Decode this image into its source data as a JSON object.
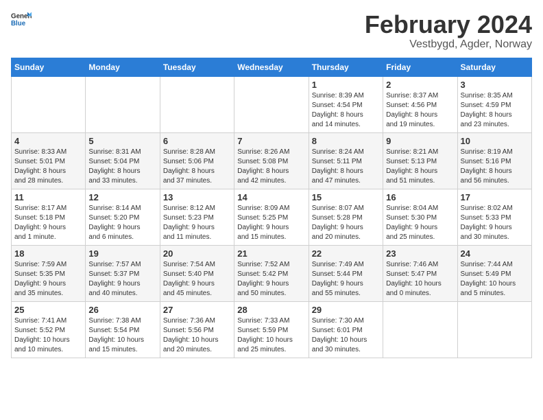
{
  "header": {
    "logo_general": "General",
    "logo_blue": "Blue",
    "title": "February 2024",
    "subtitle": "Vestbygd, Agder, Norway"
  },
  "calendar": {
    "days_of_week": [
      "Sunday",
      "Monday",
      "Tuesday",
      "Wednesday",
      "Thursday",
      "Friday",
      "Saturday"
    ],
    "weeks": [
      [
        {
          "day": "",
          "info": ""
        },
        {
          "day": "",
          "info": ""
        },
        {
          "day": "",
          "info": ""
        },
        {
          "day": "",
          "info": ""
        },
        {
          "day": "1",
          "info": "Sunrise: 8:39 AM\nSunset: 4:54 PM\nDaylight: 8 hours\nand 14 minutes."
        },
        {
          "day": "2",
          "info": "Sunrise: 8:37 AM\nSunset: 4:56 PM\nDaylight: 8 hours\nand 19 minutes."
        },
        {
          "day": "3",
          "info": "Sunrise: 8:35 AM\nSunset: 4:59 PM\nDaylight: 8 hours\nand 23 minutes."
        }
      ],
      [
        {
          "day": "4",
          "info": "Sunrise: 8:33 AM\nSunset: 5:01 PM\nDaylight: 8 hours\nand 28 minutes."
        },
        {
          "day": "5",
          "info": "Sunrise: 8:31 AM\nSunset: 5:04 PM\nDaylight: 8 hours\nand 33 minutes."
        },
        {
          "day": "6",
          "info": "Sunrise: 8:28 AM\nSunset: 5:06 PM\nDaylight: 8 hours\nand 37 minutes."
        },
        {
          "day": "7",
          "info": "Sunrise: 8:26 AM\nSunset: 5:08 PM\nDaylight: 8 hours\nand 42 minutes."
        },
        {
          "day": "8",
          "info": "Sunrise: 8:24 AM\nSunset: 5:11 PM\nDaylight: 8 hours\nand 47 minutes."
        },
        {
          "day": "9",
          "info": "Sunrise: 8:21 AM\nSunset: 5:13 PM\nDaylight: 8 hours\nand 51 minutes."
        },
        {
          "day": "10",
          "info": "Sunrise: 8:19 AM\nSunset: 5:16 PM\nDaylight: 8 hours\nand 56 minutes."
        }
      ],
      [
        {
          "day": "11",
          "info": "Sunrise: 8:17 AM\nSunset: 5:18 PM\nDaylight: 9 hours\nand 1 minute."
        },
        {
          "day": "12",
          "info": "Sunrise: 8:14 AM\nSunset: 5:20 PM\nDaylight: 9 hours\nand 6 minutes."
        },
        {
          "day": "13",
          "info": "Sunrise: 8:12 AM\nSunset: 5:23 PM\nDaylight: 9 hours\nand 11 minutes."
        },
        {
          "day": "14",
          "info": "Sunrise: 8:09 AM\nSunset: 5:25 PM\nDaylight: 9 hours\nand 15 minutes."
        },
        {
          "day": "15",
          "info": "Sunrise: 8:07 AM\nSunset: 5:28 PM\nDaylight: 9 hours\nand 20 minutes."
        },
        {
          "day": "16",
          "info": "Sunrise: 8:04 AM\nSunset: 5:30 PM\nDaylight: 9 hours\nand 25 minutes."
        },
        {
          "day": "17",
          "info": "Sunrise: 8:02 AM\nSunset: 5:33 PM\nDaylight: 9 hours\nand 30 minutes."
        }
      ],
      [
        {
          "day": "18",
          "info": "Sunrise: 7:59 AM\nSunset: 5:35 PM\nDaylight: 9 hours\nand 35 minutes."
        },
        {
          "day": "19",
          "info": "Sunrise: 7:57 AM\nSunset: 5:37 PM\nDaylight: 9 hours\nand 40 minutes."
        },
        {
          "day": "20",
          "info": "Sunrise: 7:54 AM\nSunset: 5:40 PM\nDaylight: 9 hours\nand 45 minutes."
        },
        {
          "day": "21",
          "info": "Sunrise: 7:52 AM\nSunset: 5:42 PM\nDaylight: 9 hours\nand 50 minutes."
        },
        {
          "day": "22",
          "info": "Sunrise: 7:49 AM\nSunset: 5:44 PM\nDaylight: 9 hours\nand 55 minutes."
        },
        {
          "day": "23",
          "info": "Sunrise: 7:46 AM\nSunset: 5:47 PM\nDaylight: 10 hours\nand 0 minutes."
        },
        {
          "day": "24",
          "info": "Sunrise: 7:44 AM\nSunset: 5:49 PM\nDaylight: 10 hours\nand 5 minutes."
        }
      ],
      [
        {
          "day": "25",
          "info": "Sunrise: 7:41 AM\nSunset: 5:52 PM\nDaylight: 10 hours\nand 10 minutes."
        },
        {
          "day": "26",
          "info": "Sunrise: 7:38 AM\nSunset: 5:54 PM\nDaylight: 10 hours\nand 15 minutes."
        },
        {
          "day": "27",
          "info": "Sunrise: 7:36 AM\nSunset: 5:56 PM\nDaylight: 10 hours\nand 20 minutes."
        },
        {
          "day": "28",
          "info": "Sunrise: 7:33 AM\nSunset: 5:59 PM\nDaylight: 10 hours\nand 25 minutes."
        },
        {
          "day": "29",
          "info": "Sunrise: 7:30 AM\nSunset: 6:01 PM\nDaylight: 10 hours\nand 30 minutes."
        },
        {
          "day": "",
          "info": ""
        },
        {
          "day": "",
          "info": ""
        }
      ]
    ]
  }
}
